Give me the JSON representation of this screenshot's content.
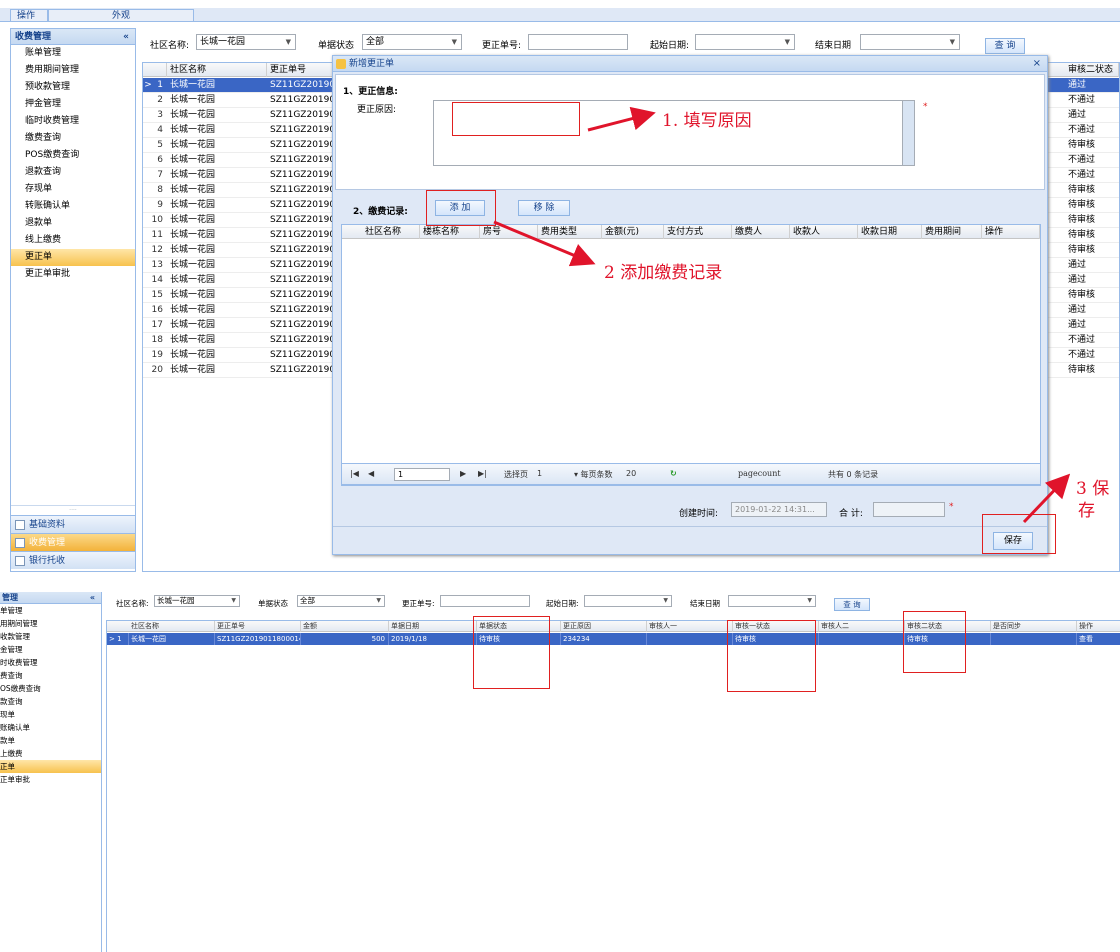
{
  "top": {
    "tabs": [
      "操作",
      "外观"
    ],
    "sidebar": {
      "title": "收费管理",
      "collapse": "«",
      "items": [
        "账单管理",
        "费用期间管理",
        "预收款管理",
        "押金管理",
        "临时收费管理",
        "缴费查询",
        "POS缴费查询",
        "退款查询",
        "存现单",
        "转账确认单",
        "退款单",
        "线上缴费",
        "更正单",
        "更正单审批"
      ],
      "selected_index": 12,
      "dots": "....",
      "accordion": [
        "基础资料",
        "收费管理",
        "银行托收"
      ]
    },
    "filter": {
      "community_label": "社区名称:",
      "community_value": "长城一花园",
      "status_label": "单据状态",
      "status_value": "全部",
      "number_label": "更正单号:",
      "start_label": "起始日期:",
      "end_label": "结束日期",
      "query_button": "查 询"
    },
    "grid": {
      "headers": [
        "社区名称",
        "更正单号",
        "审核二状态"
      ],
      "rows": [
        {
          "n": "1",
          "c": "长城一花园",
          "no": "SZ11GZ201901",
          "s": "通过"
        },
        {
          "n": "2",
          "c": "长城一花园",
          "no": "SZ11GZ201901",
          "s": "不通过"
        },
        {
          "n": "3",
          "c": "长城一花园",
          "no": "SZ11GZ201901",
          "s": "通过"
        },
        {
          "n": "4",
          "c": "长城一花园",
          "no": "SZ11GZ201901",
          "s": "不通过"
        },
        {
          "n": "5",
          "c": "长城一花园",
          "no": "SZ11GZ201901",
          "s": "待审核"
        },
        {
          "n": "6",
          "c": "长城一花园",
          "no": "SZ11GZ201901",
          "s": "不通过"
        },
        {
          "n": "7",
          "c": "长城一花园",
          "no": "SZ11GZ201901",
          "s": "不通过"
        },
        {
          "n": "8",
          "c": "长城一花园",
          "no": "SZ11GZ201901",
          "s": "待审核"
        },
        {
          "n": "9",
          "c": "长城一花园",
          "no": "SZ11GZ201901",
          "s": "待审核"
        },
        {
          "n": "10",
          "c": "长城一花园",
          "no": "SZ11GZ201901",
          "s": "待审核"
        },
        {
          "n": "11",
          "c": "长城一花园",
          "no": "SZ11GZ201901",
          "s": "待审核"
        },
        {
          "n": "12",
          "c": "长城一花园",
          "no": "SZ11GZ201901",
          "s": "待审核"
        },
        {
          "n": "13",
          "c": "长城一花园",
          "no": "SZ11GZ201901",
          "s": "通过"
        },
        {
          "n": "14",
          "c": "长城一花园",
          "no": "SZ11GZ201901",
          "s": "通过"
        },
        {
          "n": "15",
          "c": "长城一花园",
          "no": "SZ11GZ201901",
          "s": "待审核"
        },
        {
          "n": "16",
          "c": "长城一花园",
          "no": "SZ11GZ201901",
          "s": "通过"
        },
        {
          "n": "17",
          "c": "长城一花园",
          "no": "SZ11GZ201901",
          "s": "通过"
        },
        {
          "n": "18",
          "c": "长城一花园",
          "no": "SZ11GZ201901",
          "s": "不通过"
        },
        {
          "n": "19",
          "c": "长城一花园",
          "no": "SZ11GZ201901",
          "s": "不通过"
        },
        {
          "n": "20",
          "c": "长城一花园",
          "no": "SZ11GZ201901",
          "s": "待审核"
        }
      ]
    },
    "modal": {
      "title": "新增更正单",
      "close": "×",
      "section1": "1、更正信息:",
      "reason_label": "更正原因:",
      "required_mark": "*",
      "section2": "2、缴费记录:",
      "add_button": "添 加",
      "remove_button": "移 除",
      "sub_headers": [
        "社区名称",
        "楼栋名称",
        "房号",
        "费用类型",
        "金额(元)",
        "支付方式",
        "缴费人",
        "收款人",
        "收款日期",
        "费用期间",
        "操作"
      ],
      "pager": {
        "first": "|◀",
        "prev": "◀",
        "page": "1",
        "next": "▶",
        "last": "▶|",
        "select_label": "选择页",
        "select_value": "1",
        "per_label": "▾ 每页条数",
        "per_value": "20",
        "refresh": "↻",
        "pagecount": "pagecount",
        "total": "共有 0 条记录"
      },
      "created_label": "创建时间:",
      "created_value": "2019-01-22 14:31...",
      "sum_label": "合 计:",
      "save_button": "保存"
    },
    "annotations": {
      "a1": "1. 填写原因",
      "a2": "2 添加缴费记录",
      "a3_line1": "3 保",
      "a3_line2": "存"
    }
  },
  "bottom": {
    "sidebar": {
      "title": "管理",
      "collapse": "«",
      "items": [
        "单管理",
        "用期间管理",
        "收款管理",
        "金管理",
        "时收费管理",
        "费查询",
        "OS缴费查询",
        "款查询",
        "现单",
        "账确认单",
        "款单",
        "上缴费",
        "正单",
        "正单审批"
      ],
      "selected_index": 12
    },
    "filter": {
      "community_label": "社区名称:",
      "community_value": "长城一花园",
      "status_label": "单据状态",
      "status_value": "全部",
      "number_label": "更正单号:",
      "start_label": "起始日期:",
      "end_label": "结束日期",
      "query_button": "查 询"
    },
    "grid": {
      "headers": [
        "社区名称",
        "更正单号",
        "金额",
        "单据日期",
        "单据状态",
        "更正原因",
        "审核人一",
        "审核一状态",
        "审核人二",
        "审核二状态",
        "是否同步",
        "操作"
      ],
      "row": {
        "n": "1",
        "community": "长城一花园",
        "number": "SZ11GZ2019011800014",
        "amount": "500",
        "date": "2019/1/18",
        "status": "待审核",
        "reason": "234234",
        "reviewer1": "",
        "status1": "待审核",
        "reviewer2": "",
        "status2": "待审核",
        "sync": "",
        "action": "查看"
      }
    }
  }
}
